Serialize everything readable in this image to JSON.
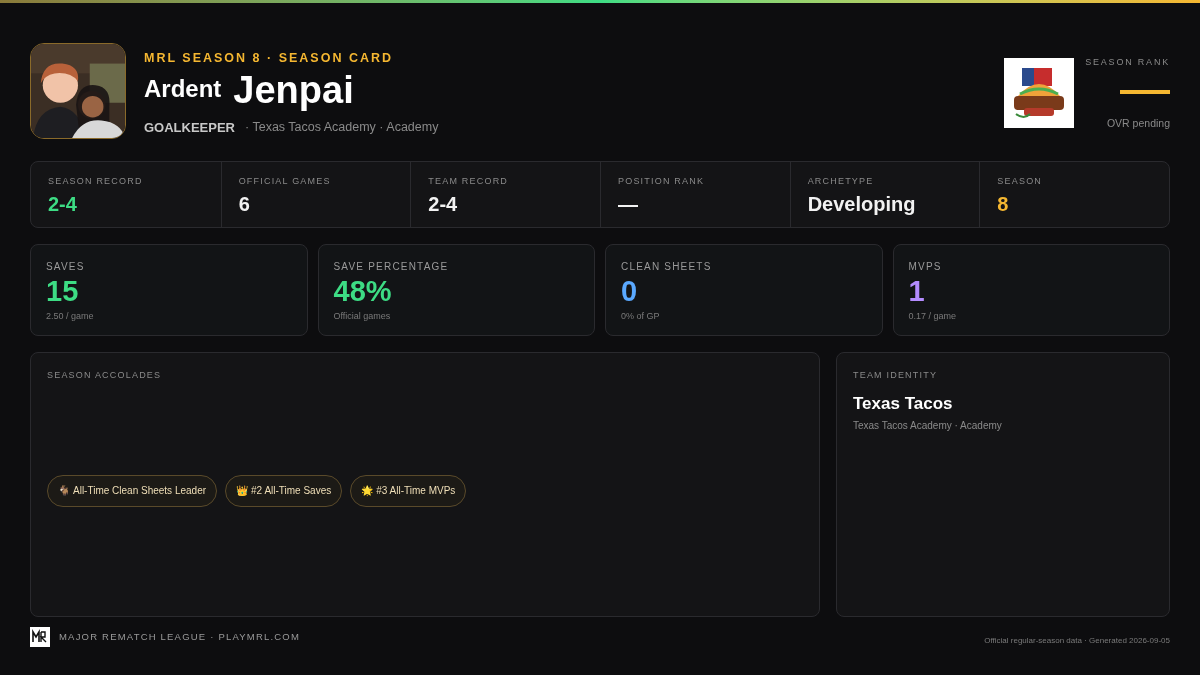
{
  "header": {
    "eyebrow": "MRL SEASON 8 · SEASON CARD",
    "prefix": "Ardent",
    "name": "Jenpai",
    "position": "GOALKEEPER",
    "team_line": "· Texas Tacos Academy · Academy"
  },
  "season_rank": {
    "label": "SEASON RANK",
    "note": "OVR pending"
  },
  "summary": [
    {
      "label": "SEASON RECORD",
      "value": "2-4",
      "color": "#3ddc84"
    },
    {
      "label": "OFFICIAL GAMES",
      "value": "6",
      "color": "#f2f2f2"
    },
    {
      "label": "TEAM RECORD",
      "value": "2-4",
      "color": "#f2f2f2"
    },
    {
      "label": "POSITION RANK",
      "value": "—",
      "color": "#f2f2f2"
    },
    {
      "label": "ARCHETYPE",
      "value": "Developing",
      "color": "#f2f2f2"
    },
    {
      "label": "SEASON",
      "value": "8",
      "color": "#f5b731"
    }
  ],
  "stats": [
    {
      "label": "SAVES",
      "value": "15",
      "sub": "2.50 / game",
      "color": "#3ddc84"
    },
    {
      "label": "SAVE PERCENTAGE",
      "value": "48%",
      "sub": "Official games",
      "color": "#3ddc84"
    },
    {
      "label": "CLEAN SHEETS",
      "value": "0",
      "sub": "0% of GP",
      "color": "#5aa9ff"
    },
    {
      "label": "MVPS",
      "value": "1",
      "sub": "0.17 / game",
      "color": "#b48cff"
    }
  ],
  "accolades": {
    "title": "SEASON ACCOLADES",
    "items": [
      {
        "icon": "🐐",
        "text": "All-Time Clean Sheets Leader"
      },
      {
        "icon": "👑",
        "text": "#2 All-Time Saves"
      },
      {
        "icon": "🌟",
        "text": "#3 All-Time MVPs"
      }
    ]
  },
  "team_identity": {
    "title": "TEAM IDENTITY",
    "team": "Texas Tacos",
    "sub": "Texas Tacos Academy · Academy"
  },
  "footer": {
    "brand": "MAJOR REMATCH LEAGUE · PLAYMRL.COM",
    "note": "Official regular-season data · Generated 2026-09-05"
  }
}
